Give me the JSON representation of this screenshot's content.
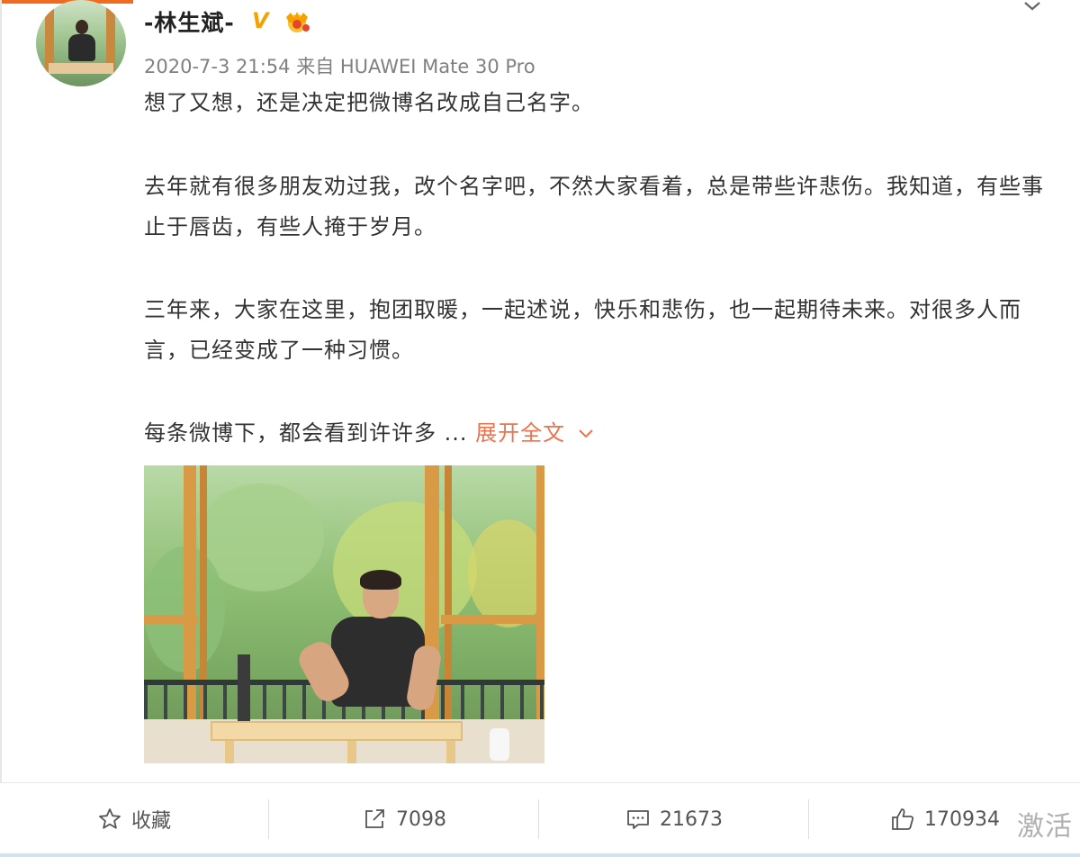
{
  "post": {
    "username": "-林生斌-",
    "verified_badge": "V",
    "meta": "2020-7-3 21:54 来自 HUAWEI Mate 30 Pro",
    "paragraphs": [
      "想了又想，还是决定把微博名改成自己名字。",
      "去年就有很多朋友劝过我，改个名字吧，不然大家看着，总是带些许悲伤。我知道，有些事止于唇齿，有些人掩于岁月。",
      "三年来，大家在这里，抱团取暖，一起述说，快乐和悲伤，也一起期待未来。对很多人而言，已经变成了一种习惯。",
      "每条微博下，都会看到许许多 ..."
    ],
    "expand_label": "展开全文",
    "photo_alt": "",
    "icons": {
      "crown": "crown-badge-icon",
      "menu": "chevron-down-icon",
      "expand": "chevron-down-icon"
    }
  },
  "actions": {
    "favorite": {
      "label": "收藏",
      "icon": "star-icon"
    },
    "repost": {
      "count": "7098",
      "icon": "share-icon"
    },
    "comment": {
      "count": "21673",
      "icon": "comment-icon"
    },
    "like": {
      "count": "170934",
      "icon": "thumbs-up-icon"
    }
  },
  "watermark": "激活",
  "colors": {
    "accent": "#eb7350",
    "badge": "#f5a200",
    "meta": "#808080",
    "text": "#333333"
  }
}
